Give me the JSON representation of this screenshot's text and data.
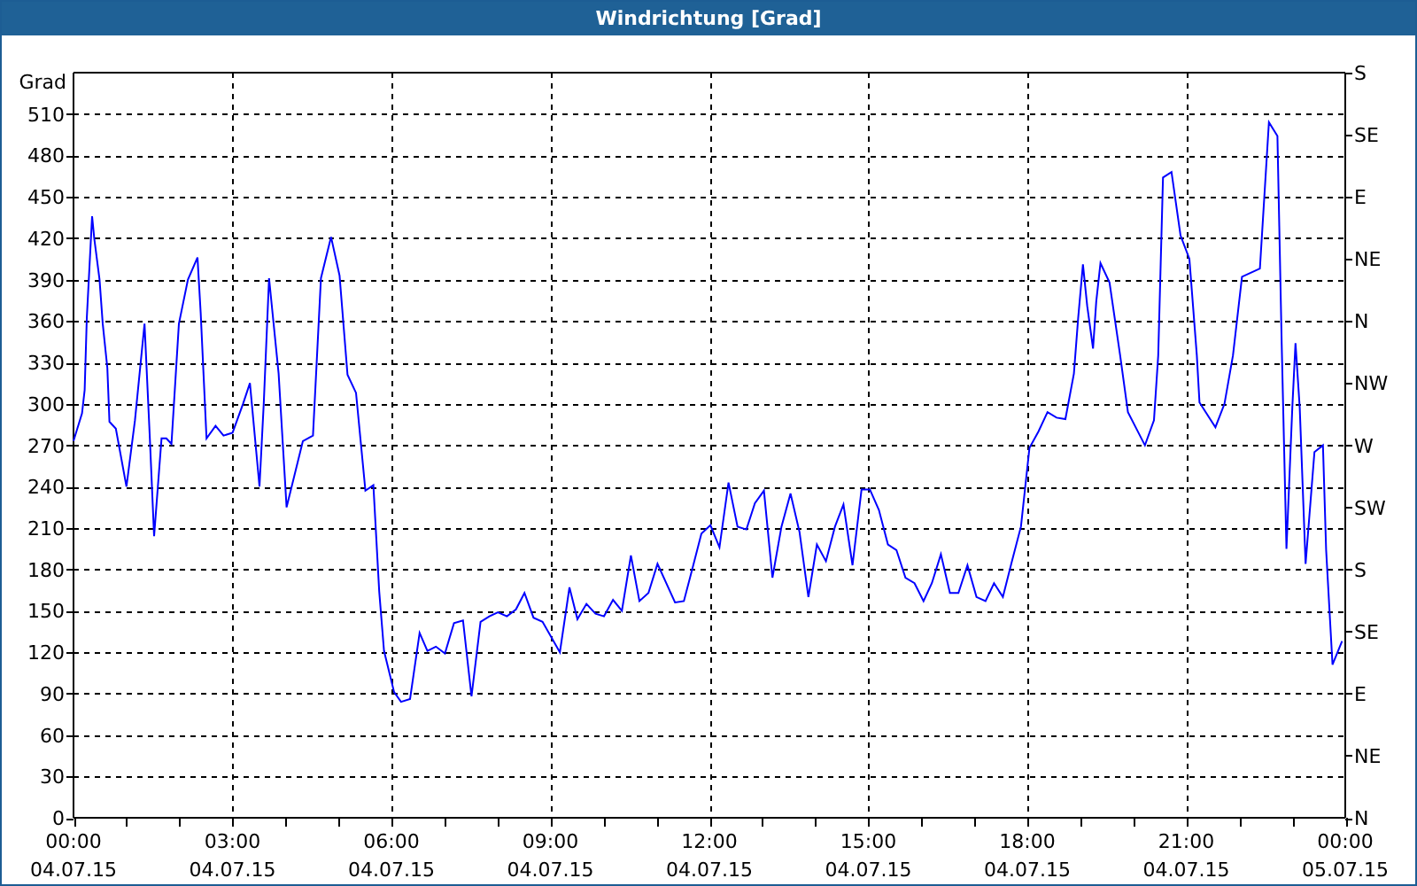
{
  "window": {
    "title": "Windrichtung [Grad]"
  },
  "chart": {
    "compass_labels": [
      "S",
      "SE",
      "E",
      "NE",
      "N",
      "NW",
      "W",
      "SW",
      "S",
      "SE",
      "E",
      "NE",
      "N"
    ],
    "x_dates": [
      "04.07.15",
      "04.07.15",
      "04.07.15",
      "04.07.15",
      "04.07.15",
      "04.07.15",
      "04.07.15",
      "04.07.15",
      "05.07.15"
    ],
    "chart_data": {
      "type": "line",
      "grid": true,
      "ylabel": "Grad",
      "xlim": [
        0,
        24
      ],
      "ylim": [
        0,
        540
      ],
      "xticks": [
        {
          "value": 0,
          "label": "00:00"
        },
        {
          "value": 3,
          "label": "03:00"
        },
        {
          "value": 6,
          "label": "06:00"
        },
        {
          "value": 9,
          "label": "09:00"
        },
        {
          "value": 12,
          "label": "12:00"
        },
        {
          "value": 15,
          "label": "15:00"
        },
        {
          "value": 18,
          "label": "18:00"
        },
        {
          "value": 21,
          "label": "21:00"
        },
        {
          "value": 24,
          "label": "00:00"
        }
      ],
      "yticks": [
        0,
        30,
        60,
        90,
        120,
        150,
        180,
        210,
        240,
        270,
        300,
        330,
        360,
        390,
        420,
        450,
        480,
        510
      ],
      "x": [
        0,
        0.16,
        0.21,
        0.25,
        0.35,
        0.39,
        0.49,
        0.55,
        0.64,
        0.68,
        0.8,
        1.0,
        1.16,
        1.34,
        1.44,
        1.52,
        1.66,
        1.75,
        1.85,
        1.99,
        2.16,
        2.34,
        2.4,
        2.51,
        2.68,
        2.83,
        3.0,
        3.2,
        3.33,
        3.51,
        3.59,
        3.69,
        3.87,
        4.02,
        4.33,
        4.52,
        4.67,
        4.86,
        5.02,
        5.17,
        5.33,
        5.51,
        5.66,
        5.77,
        5.86,
        6.05,
        6.18,
        6.35,
        6.53,
        6.68,
        6.84,
        7.01,
        7.18,
        7.35,
        7.51,
        7.68,
        7.85,
        8.01,
        8.18,
        8.35,
        8.51,
        8.68,
        8.85,
        9.18,
        9.36,
        9.51,
        9.68,
        9.85,
        10.01,
        10.18,
        10.35,
        10.52,
        10.68,
        10.85,
        11.02,
        11.35,
        11.52,
        11.69,
        11.85,
        12.02,
        12.19,
        12.36,
        12.53,
        12.7,
        12.86,
        13.03,
        13.19,
        13.36,
        13.53,
        13.7,
        13.87,
        14.03,
        14.2,
        14.37,
        14.53,
        14.7,
        14.87,
        15.03,
        15.2,
        15.37,
        15.53,
        15.7,
        15.87,
        16.04,
        16.2,
        16.37,
        16.54,
        16.7,
        16.87,
        17.04,
        17.21,
        17.37,
        17.54,
        17.71,
        17.88,
        18.04,
        18.21,
        18.38,
        18.55,
        18.72,
        18.88,
        18.96,
        19.05,
        19.13,
        19.24,
        19.3,
        19.38,
        19.55,
        19.75,
        19.9,
        20.22,
        20.39,
        20.47,
        20.56,
        20.72,
        20.89,
        21.06,
        21.2,
        21.25,
        21.55,
        21.72,
        21.88,
        22.05,
        22.39,
        22.56,
        22.72,
        22.8,
        22.89,
        23.0,
        23.06,
        23.14,
        23.25,
        23.42,
        23.58,
        23.64,
        23.76,
        23.94
      ],
      "series": [
        {
          "color": "#0000ff",
          "values": [
            273,
            293,
            310,
            362,
            436,
            420,
            390,
            358,
            326,
            287,
            282,
            240,
            288,
            358,
            275,
            204,
            275,
            275,
            271,
            358,
            390,
            406,
            366,
            275,
            284,
            277,
            279,
            300,
            315,
            240,
            300,
            391,
            322,
            225,
            273,
            277,
            391,
            421,
            393,
            321,
            308,
            237,
            241,
            164,
            121,
            91,
            84,
            86,
            134,
            121,
            124,
            119,
            141,
            143,
            88,
            142,
            146,
            149,
            146,
            151,
            163,
            145,
            142,
            120,
            167,
            144,
            155,
            148,
            146,
            158,
            150,
            190,
            157,
            163,
            184,
            156,
            157,
            182,
            206,
            212,
            196,
            243,
            211,
            209,
            228,
            237,
            174,
            211,
            235,
            207,
            160,
            198,
            186,
            211,
            227,
            183,
            238,
            238,
            223,
            198,
            194,
            174,
            170,
            157,
            170,
            191,
            163,
            163,
            183,
            160,
            157,
            170,
            160,
            186,
            211,
            268,
            280,
            294,
            290,
            289,
            322,
            362,
            401,
            371,
            340,
            374,
            402,
            388,
            335,
            294,
            270,
            288,
            335,
            464,
            468,
            422,
            405,
            335,
            301,
            283,
            300,
            335,
            392,
            398,
            504,
            494,
            344,
            195,
            297,
            344,
            297,
            184,
            265,
            270,
            194,
            111,
            128
          ]
        }
      ]
    }
  }
}
